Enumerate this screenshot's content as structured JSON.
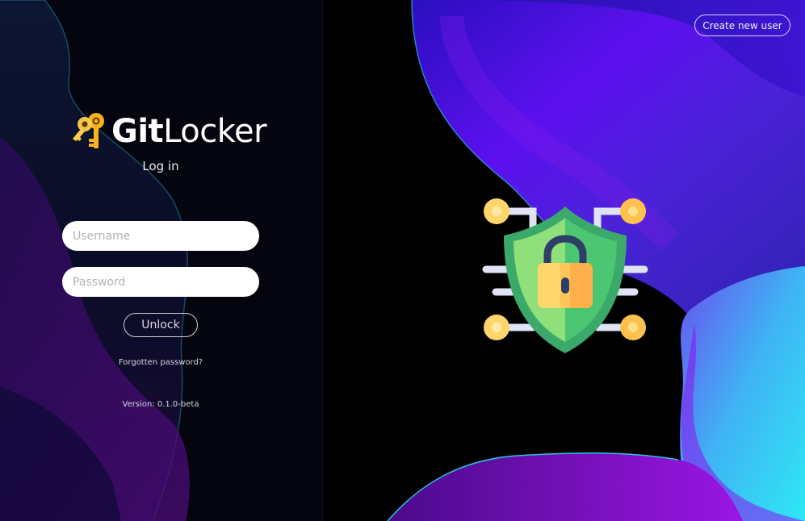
{
  "app": {
    "name_bold": "Git",
    "name_light": "Locker",
    "subtitle": "Log in"
  },
  "form": {
    "username_placeholder": "Username",
    "password_placeholder": "Password",
    "unlock_label": "Unlock",
    "forgot_label": "Forgotten password?",
    "version_label": "Version: 0.1.0-beta"
  },
  "header": {
    "create_user_label": "Create new user"
  },
  "icons": {
    "logo": "keys-icon",
    "illustration": "security-shield-lock-icon"
  },
  "colors": {
    "background": "#000000",
    "accent_purple": "#5a10e8",
    "accent_cyan": "#2ad7f0",
    "shield_green": "#4cc672",
    "lock_yellow": "#ffd66b"
  }
}
